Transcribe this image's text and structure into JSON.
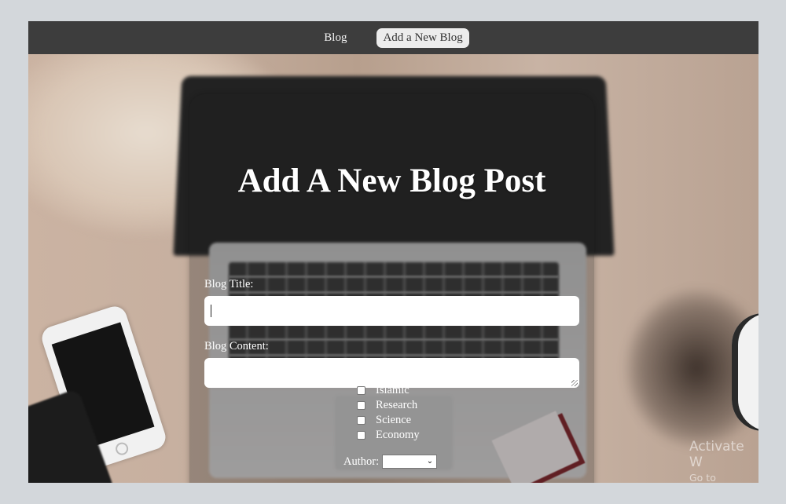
{
  "nav": {
    "items": [
      {
        "label": "Blog",
        "active": false
      },
      {
        "label": "Add a New Blog",
        "active": true
      }
    ]
  },
  "form": {
    "title": "Add A New Blog Post",
    "blog_title_label": "Blog Title:",
    "blog_title_value": "",
    "blog_content_label": "Blog Content:",
    "blog_content_value": "",
    "categories": [
      {
        "label": "Islamic",
        "checked": false
      },
      {
        "label": "Research",
        "checked": false
      },
      {
        "label": "Science",
        "checked": false
      },
      {
        "label": "Economy",
        "checked": false
      }
    ],
    "author_label": "Author:",
    "author_selected": ""
  },
  "watermark": {
    "line1": "Activate W",
    "line2": "Go to Settings"
  },
  "colors": {
    "navbar_bg": "#3d3d3d",
    "active_nav_bg": "#ececec",
    "card_overlay": "rgba(30,30,30,0.28)",
    "text_light": "#ffffff"
  }
}
